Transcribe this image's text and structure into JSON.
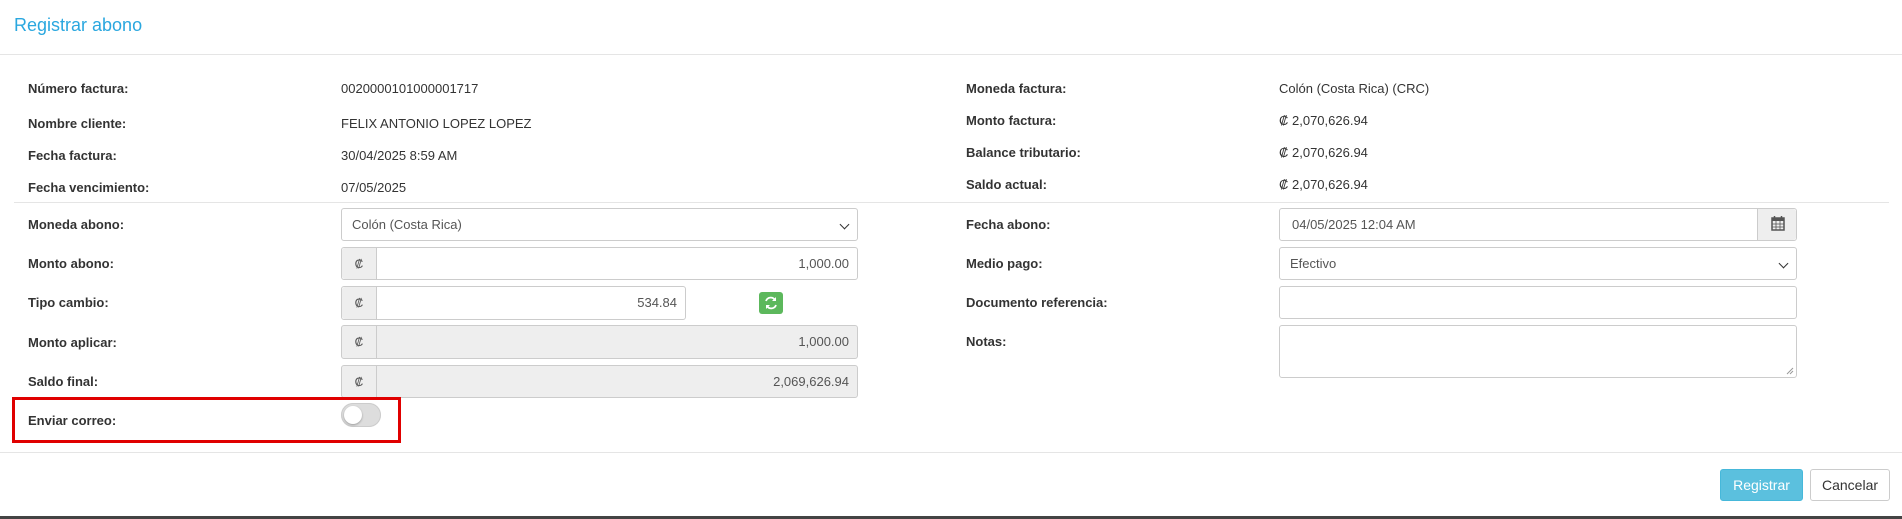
{
  "modal": {
    "title": "Registrar abono"
  },
  "info_left": [
    {
      "label": "Número factura:",
      "value": "0020000101000001717"
    },
    {
      "label": "Nombre cliente:",
      "value": "FELIX ANTONIO LOPEZ LOPEZ"
    },
    {
      "label": "Fecha factura:",
      "value": "30/04/2025 8:59 AM"
    },
    {
      "label": "Fecha vencimiento:",
      "value": "07/05/2025"
    }
  ],
  "info_right": [
    {
      "label": "Moneda factura:",
      "value": "Colón (Costa Rica) (CRC)"
    },
    {
      "label": "Monto factura:",
      "value": "₡ 2,070,626.94"
    },
    {
      "label": "Balance tributario:",
      "value": "₡ 2,070,626.94"
    },
    {
      "label": "Saldo actual:",
      "value": "₡ 2,070,626.94"
    }
  ],
  "form_left": {
    "moneda_abono": {
      "label": "Moneda abono:",
      "value": "Colón (Costa Rica)"
    },
    "monto_abono": {
      "label": "Monto abono:",
      "symbol": "₡",
      "value": "1,000.00"
    },
    "tipo_cambio": {
      "label": "Tipo cambio:",
      "symbol": "₡",
      "value": "534.84"
    },
    "monto_aplicar": {
      "label": "Monto aplicar:",
      "symbol": "₡",
      "value": "1,000.00"
    },
    "saldo_final": {
      "label": "Saldo final:",
      "symbol": "₡",
      "value": "2,069,626.94"
    },
    "enviar_correo": {
      "label": "Enviar correo:",
      "checked": false
    }
  },
  "form_right": {
    "fecha_abono": {
      "label": "Fecha abono:",
      "value": "04/05/2025 12:04 AM"
    },
    "medio_pago": {
      "label": "Medio pago:",
      "value": "Efectivo"
    },
    "documento_referencia": {
      "label": "Documento referencia:",
      "value": ""
    },
    "notas": {
      "label": "Notas:",
      "value": ""
    }
  },
  "buttons": {
    "register": "Registrar",
    "cancel": "Cancelar"
  },
  "icons": {
    "calendar": "calendar-icon",
    "refresh": "refresh-icon",
    "dropdown": "chevron-down-icon"
  },
  "colors": {
    "title": "#2aa7df",
    "primary_button": "#5bc0de",
    "refresh_button": "#5cb85c",
    "highlight": "#e00000"
  }
}
